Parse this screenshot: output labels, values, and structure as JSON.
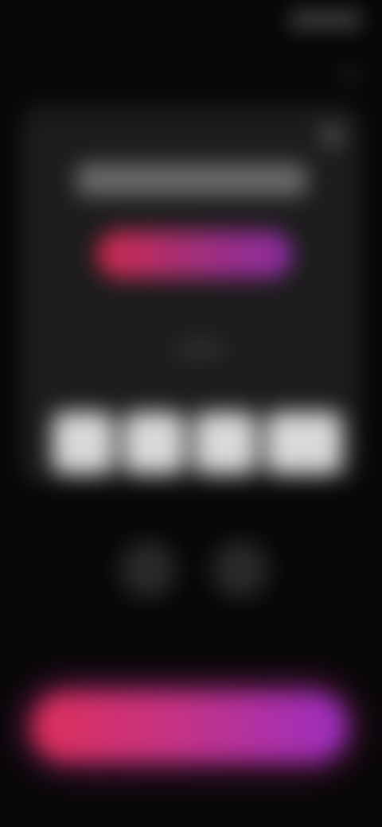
{
  "status_bar": {
    "time": "",
    "icons": [
      "signal-icon",
      "wifi-icon",
      "battery-icon"
    ]
  },
  "top": {
    "menu_icon": "more-icon"
  },
  "card": {
    "label": "",
    "title": "",
    "price": "",
    "countdown_label": "",
    "countdown": "",
    "close_icon": "close-icon"
  },
  "cta": {
    "label": ""
  },
  "colors": {
    "accent_start": "#dd2f5a",
    "accent_mid": "#c63384",
    "accent_end": "#9b2ec1",
    "card_bg": "#1c1c1c"
  }
}
